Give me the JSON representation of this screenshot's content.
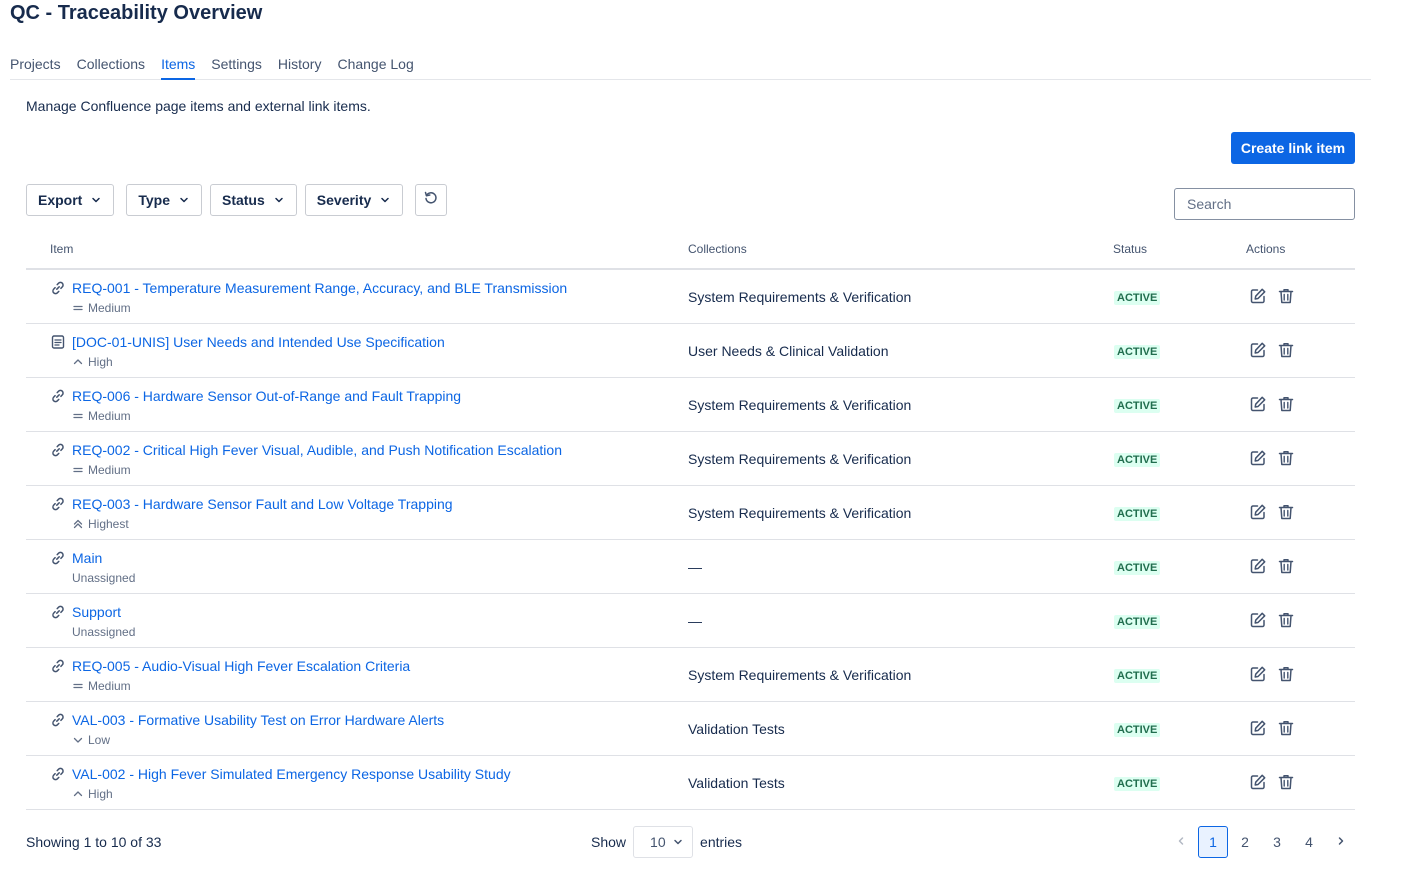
{
  "page": {
    "title": "QC - Traceability Overview",
    "description": "Manage Confluence page items and external link items."
  },
  "tabs": [
    {
      "label": "Projects",
      "active": false
    },
    {
      "label": "Collections",
      "active": false
    },
    {
      "label": "Items",
      "active": true
    },
    {
      "label": "Settings",
      "active": false
    },
    {
      "label": "History",
      "active": false
    },
    {
      "label": "Change Log",
      "active": false
    }
  ],
  "toolbar": {
    "create_label": "Create link item",
    "filters": [
      "Export",
      "Type",
      "Status",
      "Severity"
    ],
    "reset_icon": "refresh-icon",
    "search_placeholder": "Search"
  },
  "table": {
    "headers": {
      "item": "Item",
      "collections": "Collections",
      "status": "Status",
      "actions": "Actions"
    },
    "rows": [
      {
        "type_icon": "link-icon",
        "name": "REQ-001 - Temperature Measurement Range, Accuracy, and BLE Transmission",
        "severity": "Medium",
        "severity_icon": "medium-icon",
        "collections": "System Requirements & Verification",
        "status": "ACTIVE"
      },
      {
        "type_icon": "page-icon",
        "name": "[DOC-01-UNIS] User Needs and Intended Use Specification",
        "severity": "High",
        "severity_icon": "high-icon",
        "collections": "User Needs & Clinical Validation",
        "status": "ACTIVE"
      },
      {
        "type_icon": "link-icon",
        "name": "REQ-006 - Hardware Sensor Out-of-Range and Fault Trapping",
        "severity": "Medium",
        "severity_icon": "medium-icon",
        "collections": "System Requirements & Verification",
        "status": "ACTIVE"
      },
      {
        "type_icon": "link-icon",
        "name": "REQ-002 - Critical High Fever Visual, Audible, and Push Notification Escalation",
        "severity": "Medium",
        "severity_icon": "medium-icon",
        "collections": "System Requirements & Verification",
        "status": "ACTIVE"
      },
      {
        "type_icon": "link-icon",
        "name": "REQ-003 - Hardware Sensor Fault and Low Voltage Trapping",
        "severity": "Highest",
        "severity_icon": "highest-icon",
        "collections": "System Requirements & Verification",
        "status": "ACTIVE"
      },
      {
        "type_icon": "link-icon",
        "name": "Main",
        "severity": "Unassigned",
        "severity_icon": "",
        "collections": "—",
        "status": "ACTIVE"
      },
      {
        "type_icon": "link-icon",
        "name": "Support",
        "severity": "Unassigned",
        "severity_icon": "",
        "collections": "—",
        "status": "ACTIVE"
      },
      {
        "type_icon": "link-icon",
        "name": "REQ-005 - Audio-Visual High Fever Escalation Criteria",
        "severity": "Medium",
        "severity_icon": "medium-icon",
        "collections": "System Requirements & Verification",
        "status": "ACTIVE"
      },
      {
        "type_icon": "link-icon",
        "name": "VAL-003 - Formative Usability Test on Error Hardware Alerts",
        "severity": "Low",
        "severity_icon": "low-icon",
        "collections": "Validation Tests",
        "status": "ACTIVE"
      },
      {
        "type_icon": "link-icon",
        "name": "VAL-002 - High Fever Simulated Emergency Response Usability Study",
        "severity": "High",
        "severity_icon": "high-icon",
        "collections": "Validation Tests",
        "status": "ACTIVE"
      }
    ]
  },
  "footer": {
    "showing": "Showing 1 to 10 of 33",
    "show_label": "Show",
    "page_size": "10",
    "entries_label": "entries",
    "pages": [
      "1",
      "2",
      "3",
      "4"
    ],
    "current_page": "1"
  }
}
